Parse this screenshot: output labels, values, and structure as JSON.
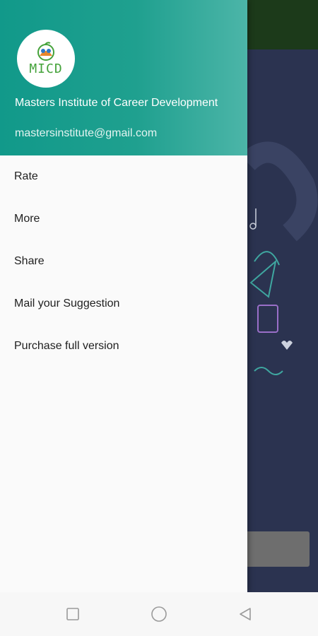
{
  "drawer": {
    "header": {
      "logo_text": "MICD",
      "org_name": "Masters Institute of Career Development",
      "email": "mastersinstitute@gmail.com"
    },
    "items": [
      {
        "label": "Rate"
      },
      {
        "label": "More"
      },
      {
        "label": "Share"
      },
      {
        "label": "Mail your Suggestion"
      },
      {
        "label": "Purchase full version"
      }
    ]
  },
  "colors": {
    "header_start": "#11998a",
    "header_end": "#4cb5a8",
    "background_app": "#2b3350",
    "background_toolbar": "#1c3a1a"
  },
  "navigation_bar": {
    "icons": [
      "recents-square-icon",
      "home-circle-icon",
      "back-triangle-icon"
    ]
  }
}
